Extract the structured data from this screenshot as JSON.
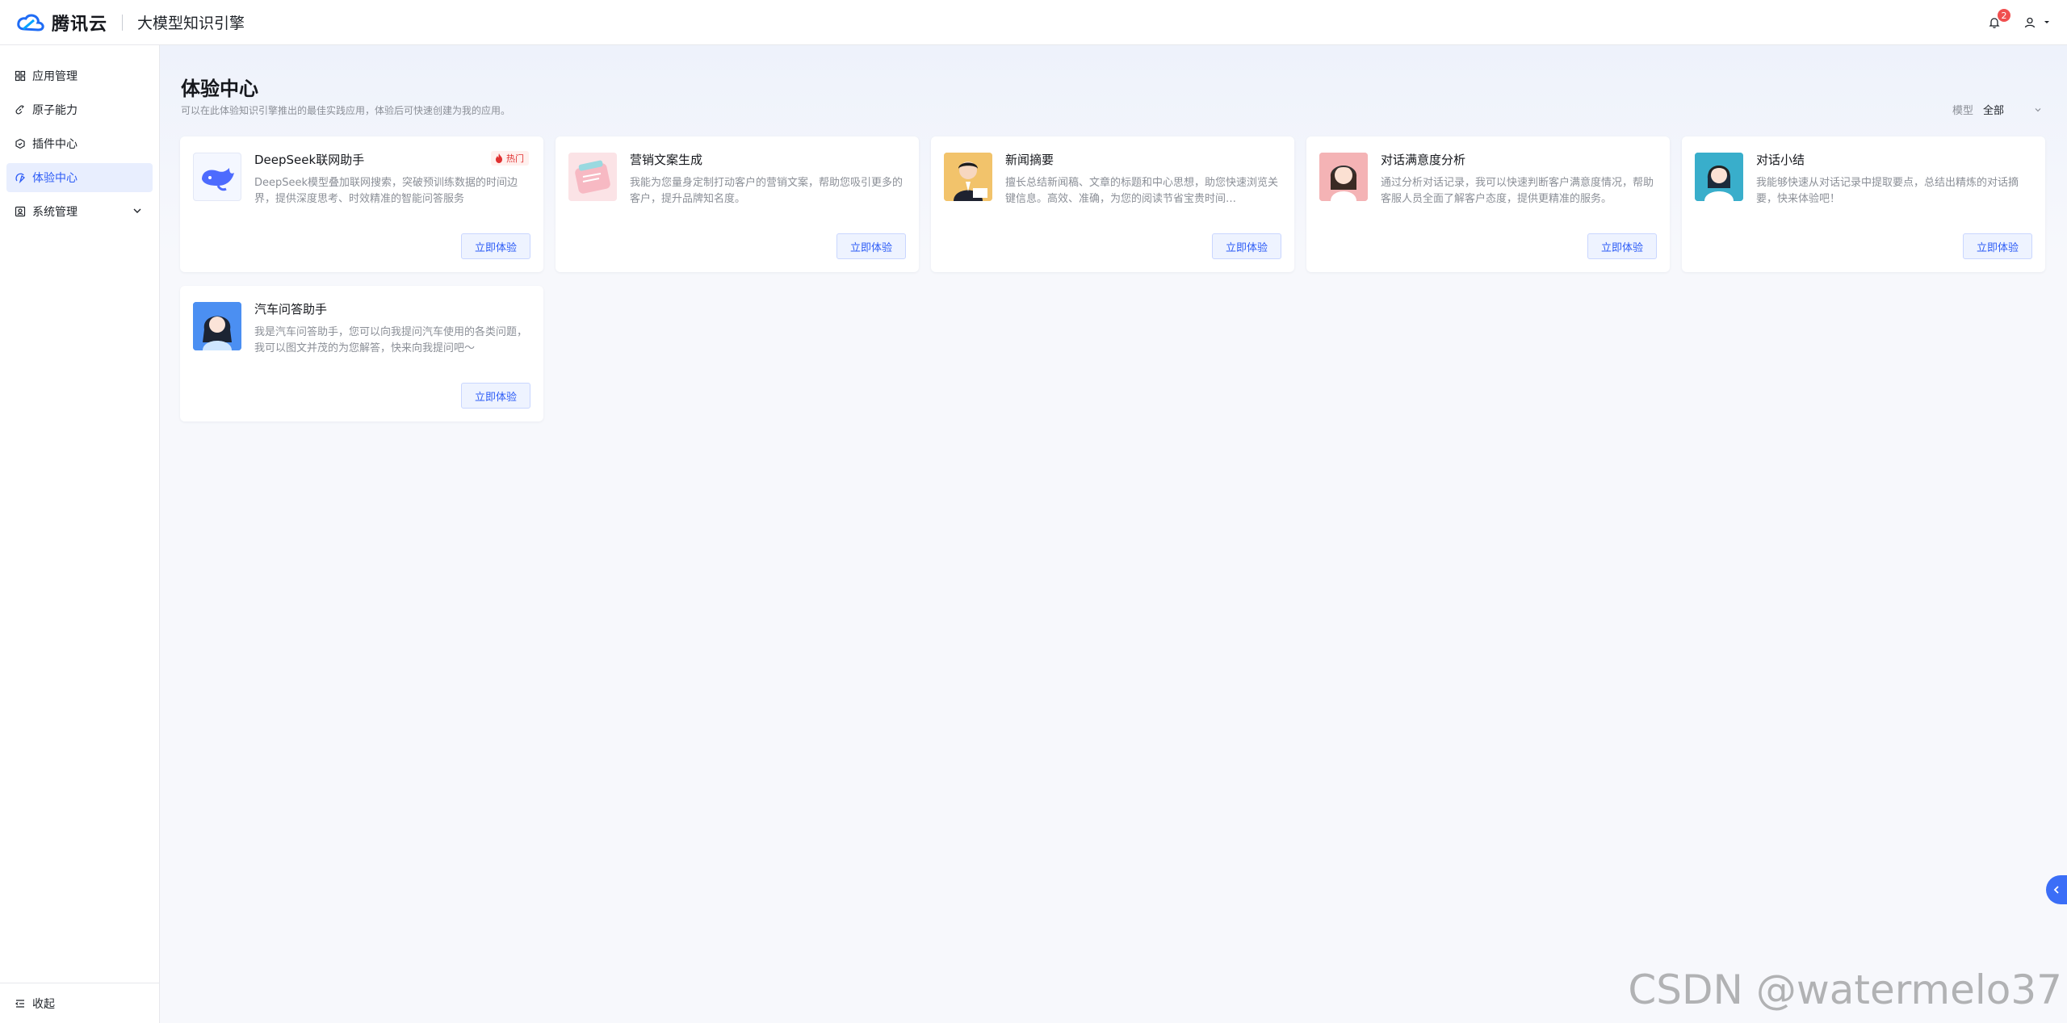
{
  "header": {
    "brand": "腾讯云",
    "product": "大模型知识引擎",
    "notification_count": "2"
  },
  "sidebar": {
    "items": [
      {
        "label": "应用管理",
        "icon": "grid-icon"
      },
      {
        "label": "原子能力",
        "icon": "link-icon"
      },
      {
        "label": "插件中心",
        "icon": "plugin-icon"
      },
      {
        "label": "体验中心",
        "icon": "experience-icon",
        "active": true
      },
      {
        "label": "系统管理",
        "icon": "system-icon",
        "expandable": true
      }
    ],
    "collapse_label": "收起"
  },
  "main": {
    "title": "体验中心",
    "description": "可以在此体验知识引擎推出的最佳实践应用，体验后可快速创建为我的应用。",
    "filter": {
      "label": "模型",
      "value": "全部"
    }
  },
  "cards": [
    {
      "title": "DeepSeek联网助手",
      "desc": "DeepSeek模型叠加联网搜索，突破预训练数据的时间边界，提供深度思考、时效精准的智能问答服务",
      "button": "立即体验",
      "hot": "热门"
    },
    {
      "title": "营销文案生成",
      "desc": "我能为您量身定制打动客户的营销文案，帮助您吸引更多的客户，提升品牌知名度。",
      "button": "立即体验"
    },
    {
      "title": "新闻摘要",
      "desc": "擅长总结新闻稿、文章的标题和中心思想，助您快速浏览关键信息。高效、准确，为您的阅读节省宝贵时间…",
      "button": "立即体验"
    },
    {
      "title": "对话满意度分析",
      "desc": "通过分析对话记录，我可以快速判断客户满意度情况，帮助客服人员全面了解客户态度，提供更精准的服务。",
      "button": "立即体验"
    },
    {
      "title": "对话小结",
      "desc": "我能够快速从对话记录中提取要点，总结出精炼的对话摘要，快来体验吧！",
      "button": "立即体验"
    },
    {
      "title": "汽车问答助手",
      "desc": "我是汽车问答助手，您可以向我提问汽车使用的各类问题，我可以图文并茂的为您解答，快来向我提问吧～",
      "button": "立即体验"
    }
  ],
  "watermark": "CSDN @watermelo37",
  "colors": {
    "accent": "#2d5cf6",
    "hot": "#e03131"
  }
}
